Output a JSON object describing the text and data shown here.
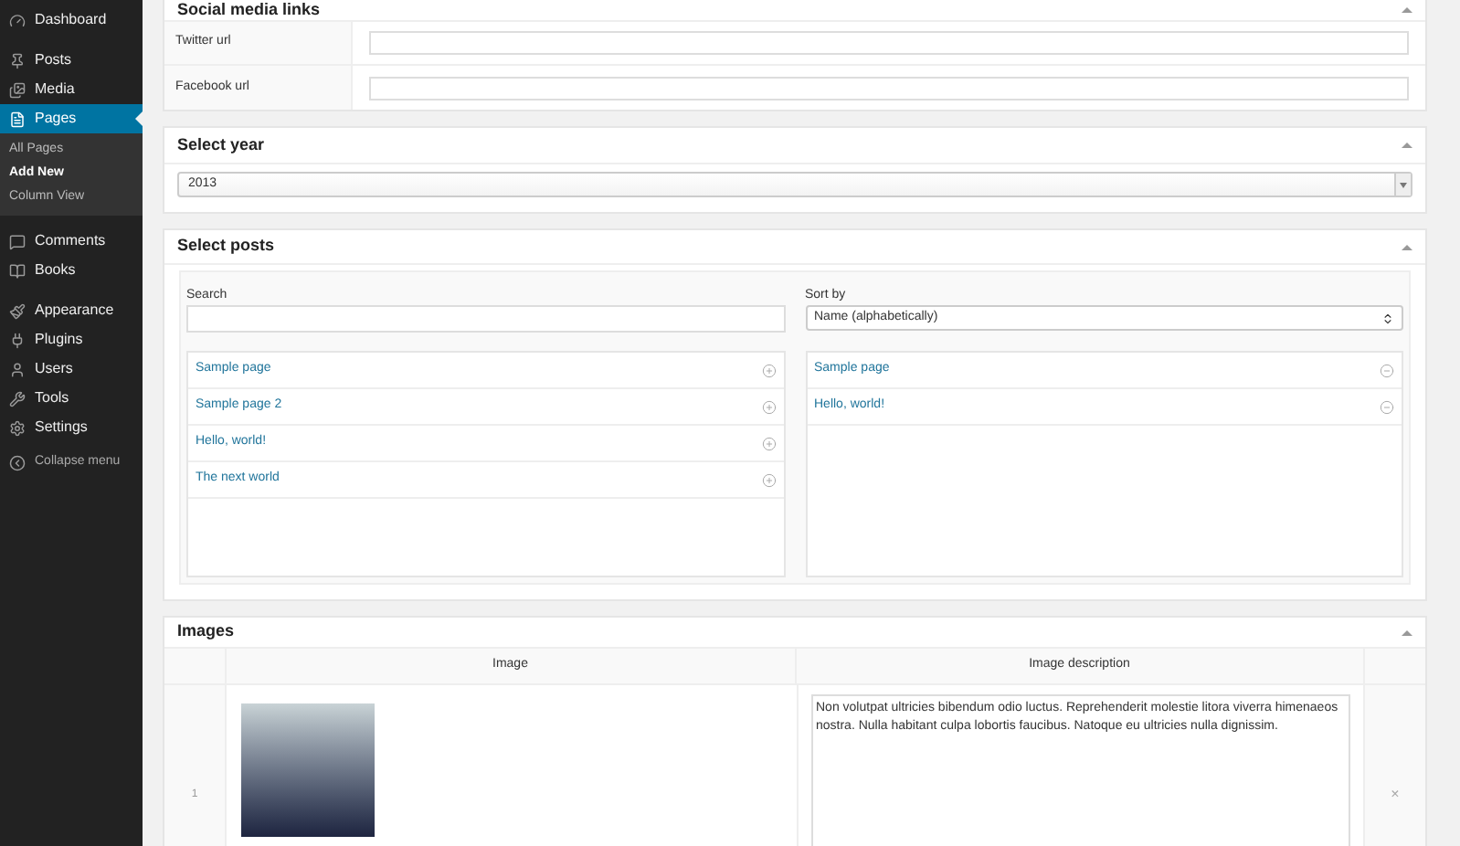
{
  "sidebar": {
    "items": [
      {
        "label": "Dashboard",
        "selected": false
      },
      {
        "label": "Posts",
        "selected": false
      },
      {
        "label": "Media",
        "selected": false
      },
      {
        "label": "Pages",
        "selected": true,
        "children": [
          {
            "label": "All Pages",
            "selected": false
          },
          {
            "label": "Add New",
            "selected": true
          },
          {
            "label": "Column View",
            "selected": false
          }
        ]
      },
      {
        "label": "Comments",
        "selected": false
      },
      {
        "label": "Books",
        "selected": false
      },
      {
        "label": "Appearance",
        "selected": false
      },
      {
        "label": "Plugins",
        "selected": false
      },
      {
        "label": "Users",
        "selected": false
      },
      {
        "label": "Tools",
        "selected": false
      },
      {
        "label": "Settings",
        "selected": false
      }
    ],
    "collapse": "Collapse menu"
  },
  "social_panel": {
    "title": "Social media links",
    "fields": [
      {
        "label": "Twitter url"
      },
      {
        "label": "Facebook url"
      }
    ]
  },
  "year_panel": {
    "title": "Select year",
    "value": "2013"
  },
  "posts_panel": {
    "title": "Select posts",
    "search_label": "Search",
    "sort_label": "Sort by",
    "sort_value": "Name (alphabetically)",
    "available": [
      "Sample page",
      "Sample page 2",
      "Hello, world!",
      "The next world"
    ],
    "selected_posts": [
      "Sample page",
      "Hello, world!"
    ]
  },
  "images_panel": {
    "title": "Images",
    "columns": [
      "Image",
      "Image description"
    ],
    "rows": [
      {
        "index": "1",
        "description": "Non volutpat ultricies bibendum odio luctus. Reprehenderit molestie litora viverra himenaeos nostra. Nulla habitant culpa lobortis faucibus. Natoque eu ultricies nulla dignissim.",
        "remove": "×"
      }
    ]
  }
}
